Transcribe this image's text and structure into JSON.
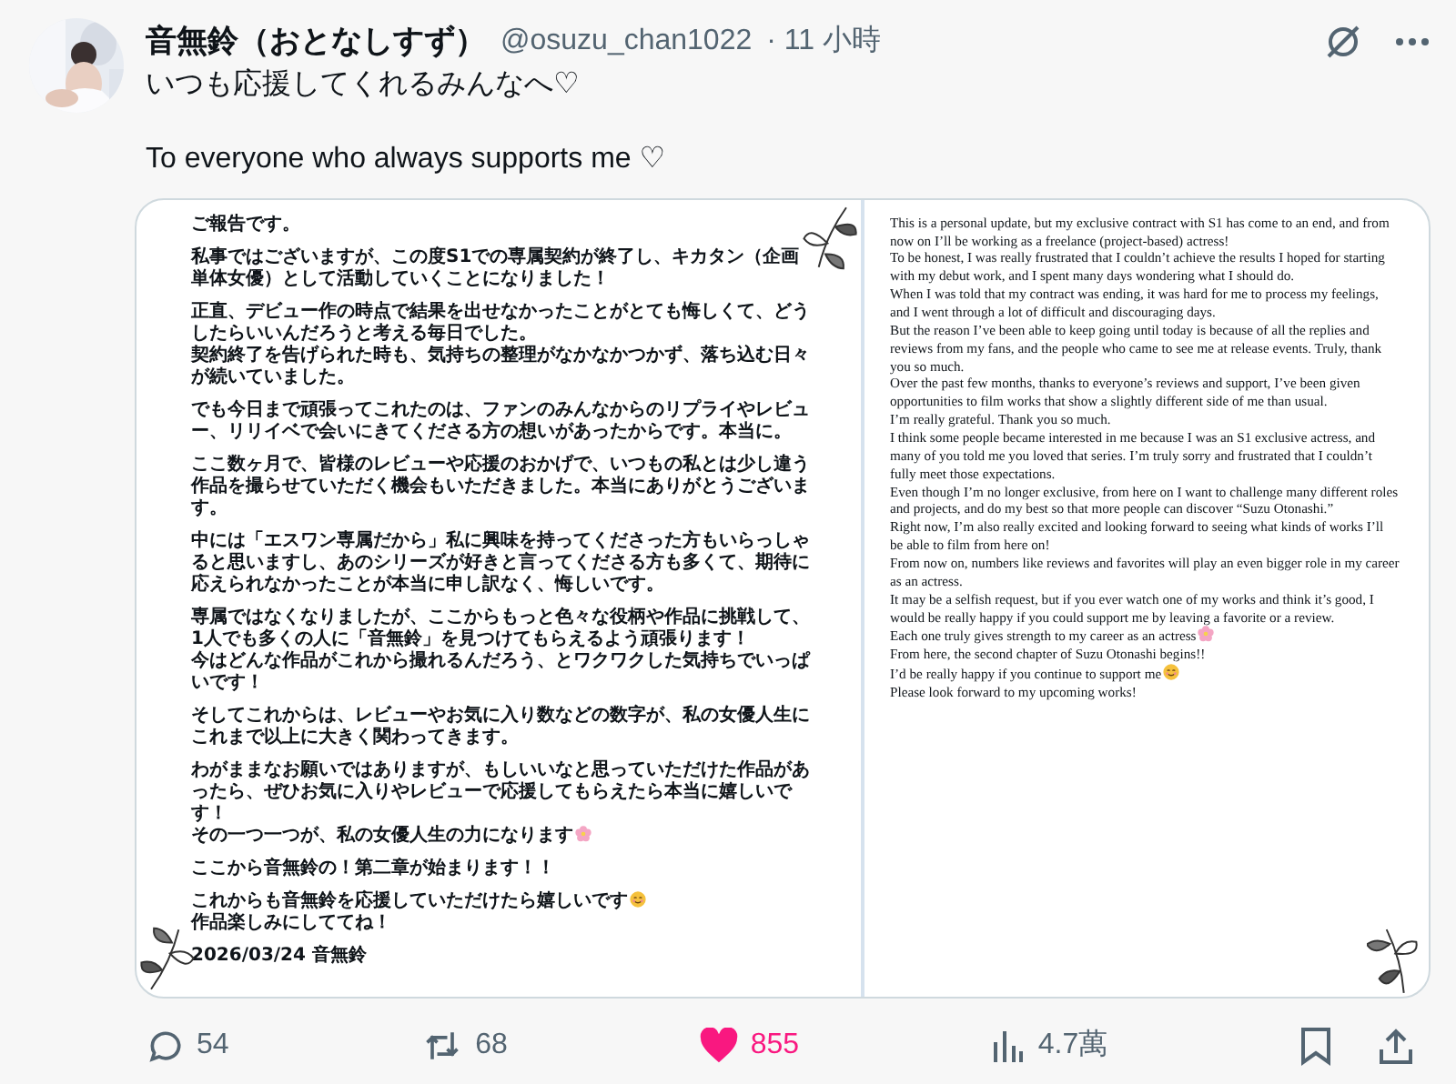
{
  "post": {
    "author": {
      "name": "音無鈴（おとなしすず）",
      "handle": "@osuzu_chan1022",
      "time": "· 11 小時"
    },
    "text": [
      "いつも応援してくれるみんなへ♡",
      "To everyone who always supports me ♡"
    ],
    "letter": {
      "japanese": [
        [
          {
            "text": "ご報告です。"
          }
        ],
        [
          {
            "text": "私事ではございますが、この度S1での専属契約が終了し、キカタン（企画単体女優）として活動していくことになりました！"
          }
        ],
        [
          {
            "text": "正直、デビュー作の時点で結果を出せなかったことがとても悔しくて、どうしたらいいんだろうと考える毎日でした。"
          },
          {
            "text": "契約終了を告げられた時も、気持ちの整理がなかなかつかず、落ち込む日々が続いていました。"
          }
        ],
        [
          {
            "text": "でも今日まで頑張ってこれたのは、ファンのみんなからのリプライやレビュー、リリイベで会いにきてくださる方の想いがあったからです。本当に。"
          }
        ],
        [
          {
            "text": "ここ数ヶ月で、皆様のレビューや応援のおかげで、いつもの私とは少し違う作品を撮らせていただく機会もいただきました。本当にありがとうございます。"
          }
        ],
        [
          {
            "text": "中には「エスワン専属だから」私に興味を持ってくださった方もいらっしゃると思いますし、あのシリーズが好きと言ってくださる方も多くて、期待に応えられなかったことが本当に申し訳なく、悔しいです。"
          }
        ],
        [
          {
            "text": "専属ではなくなりましたが、ここからもっと色々な役柄や作品に挑戦して、1人でも多くの人に「音無鈴」を見つけてもらえるよう頑張ります！"
          },
          {
            "text": "今はどんな作品がこれから撮れるんだろう、とワクワクした気持ちでいっぱいです！"
          }
        ],
        [
          {
            "text": "そしてこれからは、レビューやお気に入り数などの数字が、私の女優人生にこれまで以上に大きく関わってきます。"
          }
        ],
        [
          {
            "text": "わがままなお願いではありますが、もしいいなと思っていただけた作品があったら、ぜひお気に入りやレビューで応援してもらえたら本当に嬉しいです！"
          },
          {
            "text": "その一つ一つが、私の女優人生の力になります",
            "kind": "flower-end"
          }
        ],
        [
          {
            "text": "ここから音無鈴の！第二章が始まります！！"
          }
        ],
        [
          {
            "text": "これからも音無鈴を応援していただけたら嬉しいです",
            "kind": "smile-end"
          },
          {
            "text": "作品楽しみにしててね！"
          }
        ],
        [
          {
            "text": "2026/03/24 音無鈴"
          }
        ]
      ],
      "english": [
        {
          "text": "This is a personal update, but my exclusive contract with S1 has come to an end, and from now on I’ll be working as a freelance (project-based) actress!"
        },
        {
          "text": "To be honest, I was really frustrated that I couldn’t achieve the results I hoped for starting with my debut work, and I spent many days wondering what I should do."
        },
        {
          "text": "When I was told that my contract was ending, it was hard for me to process my feelings, and I went through a lot of difficult and discouraging days."
        },
        {
          "text": "But the reason I’ve been able to keep going until today is because of all the replies and reviews from my fans, and the people who came to see me at release events. Truly, thank you so much."
        },
        {
          "text": "Over the past few months, thanks to everyone’s reviews and support, I’ve been given opportunities to film works that show a slightly different side of me than usual."
        },
        {
          "text": "I’m really grateful. Thank you so much."
        },
        {
          "text": "I think some people became interested in me because I was an S1 exclusive actress, and many of you told me you loved that series. I’m truly sorry and frustrated that I couldn’t fully meet those expectations."
        },
        {
          "text": "Even though I’m no longer exclusive, from here on I want to challenge many different roles and projects, and do my best so that more people can discover “Suzu Otonashi.”"
        },
        {
          "text": "Right now, I’m also really excited and looking forward to seeing what kinds of works I’ll be able to film from here on!"
        },
        {
          "text": "From now on, numbers like reviews and favorites will play an even bigger role in my career as an actress."
        },
        {
          "text": "It may be a selfish request, but if you ever watch one of my works and think it’s good, I would be really happy if you could support me by leaving a favorite or a review."
        },
        {
          "text": "Each one truly gives strength to my career as an actress",
          "kind": "flower-end"
        },
        {
          "text": "From here, the second chapter of Suzu Otonashi begins!!"
        },
        {
          "text": "I’d be really happy if you continue to support me",
          "kind": "smile-end"
        },
        {
          "text": "Please look forward to my upcoming works!"
        }
      ]
    }
  },
  "actions": {
    "replies": "54",
    "reposts": "68",
    "likes": "855",
    "liked": true,
    "views": "4.7萬"
  }
}
